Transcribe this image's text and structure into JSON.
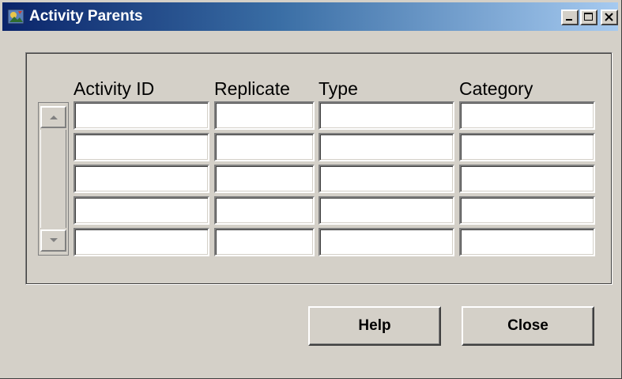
{
  "window": {
    "title": "Activity Parents",
    "controls": [
      "minimize-icon",
      "maximize-icon",
      "close-icon"
    ]
  },
  "table": {
    "headers": [
      "Activity ID",
      "Replicate",
      "Type",
      "Category"
    ],
    "rows": [
      [
        "",
        "",
        "",
        ""
      ],
      [
        "",
        "",
        "",
        ""
      ],
      [
        "",
        "",
        "",
        ""
      ],
      [
        "",
        "",
        "",
        ""
      ],
      [
        "",
        "",
        "",
        ""
      ]
    ]
  },
  "buttons": {
    "help": "Help",
    "close": "Close"
  },
  "colors": {
    "face": "#d4d0c8",
    "title_start": "#0a246a",
    "title_end": "#a6caf0"
  }
}
